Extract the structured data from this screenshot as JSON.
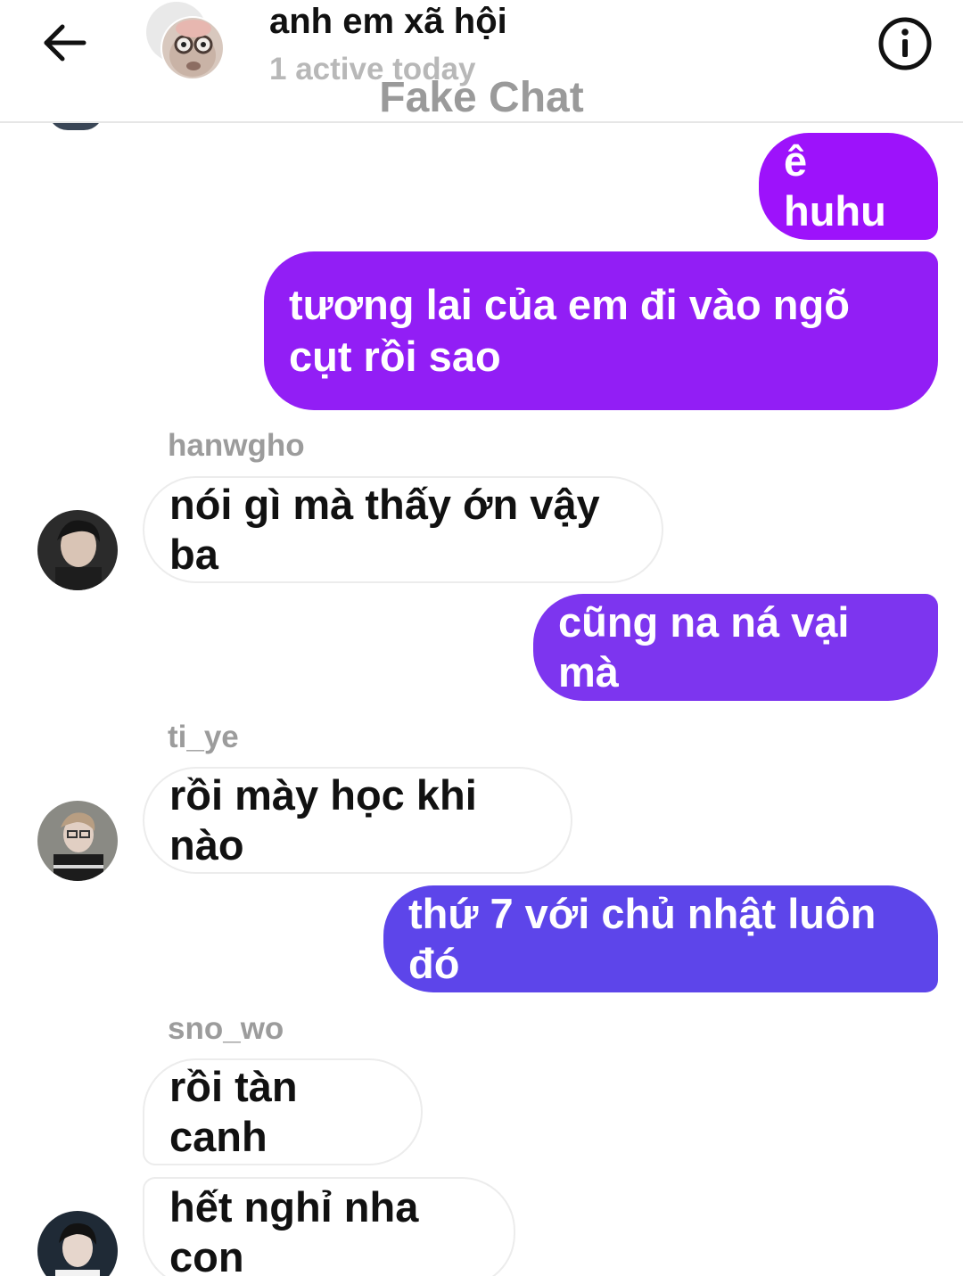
{
  "header": {
    "title": "anh em xã hội",
    "subtitle": "1 active today",
    "watermark": "Fake Chat"
  },
  "messages": [
    {
      "side": "out",
      "text": "ê huhu",
      "color": "#9d12fb"
    },
    {
      "side": "out",
      "text": "tương lai của em đi vào ngõ cụt rồi sao",
      "color": "#921ef5"
    },
    {
      "side": "in",
      "sender": "hanwgho",
      "text": "nói gì mà thấy ớn vậy ba"
    },
    {
      "side": "out",
      "text": "cũng na ná vại mà",
      "color": "#7d35ef"
    },
    {
      "side": "in",
      "sender": "ti_ye",
      "text": "rồi mày học khi nào"
    },
    {
      "side": "out",
      "text": "thứ 7 với chủ nhật luôn đó",
      "color": "#5d45ea"
    },
    {
      "side": "in",
      "sender": "sno_wo",
      "text": "rồi tàn canh"
    },
    {
      "side": "in",
      "text": "hết nghỉ nha con"
    }
  ],
  "icons": {
    "back": "arrow-left-icon",
    "info": "info-icon"
  }
}
